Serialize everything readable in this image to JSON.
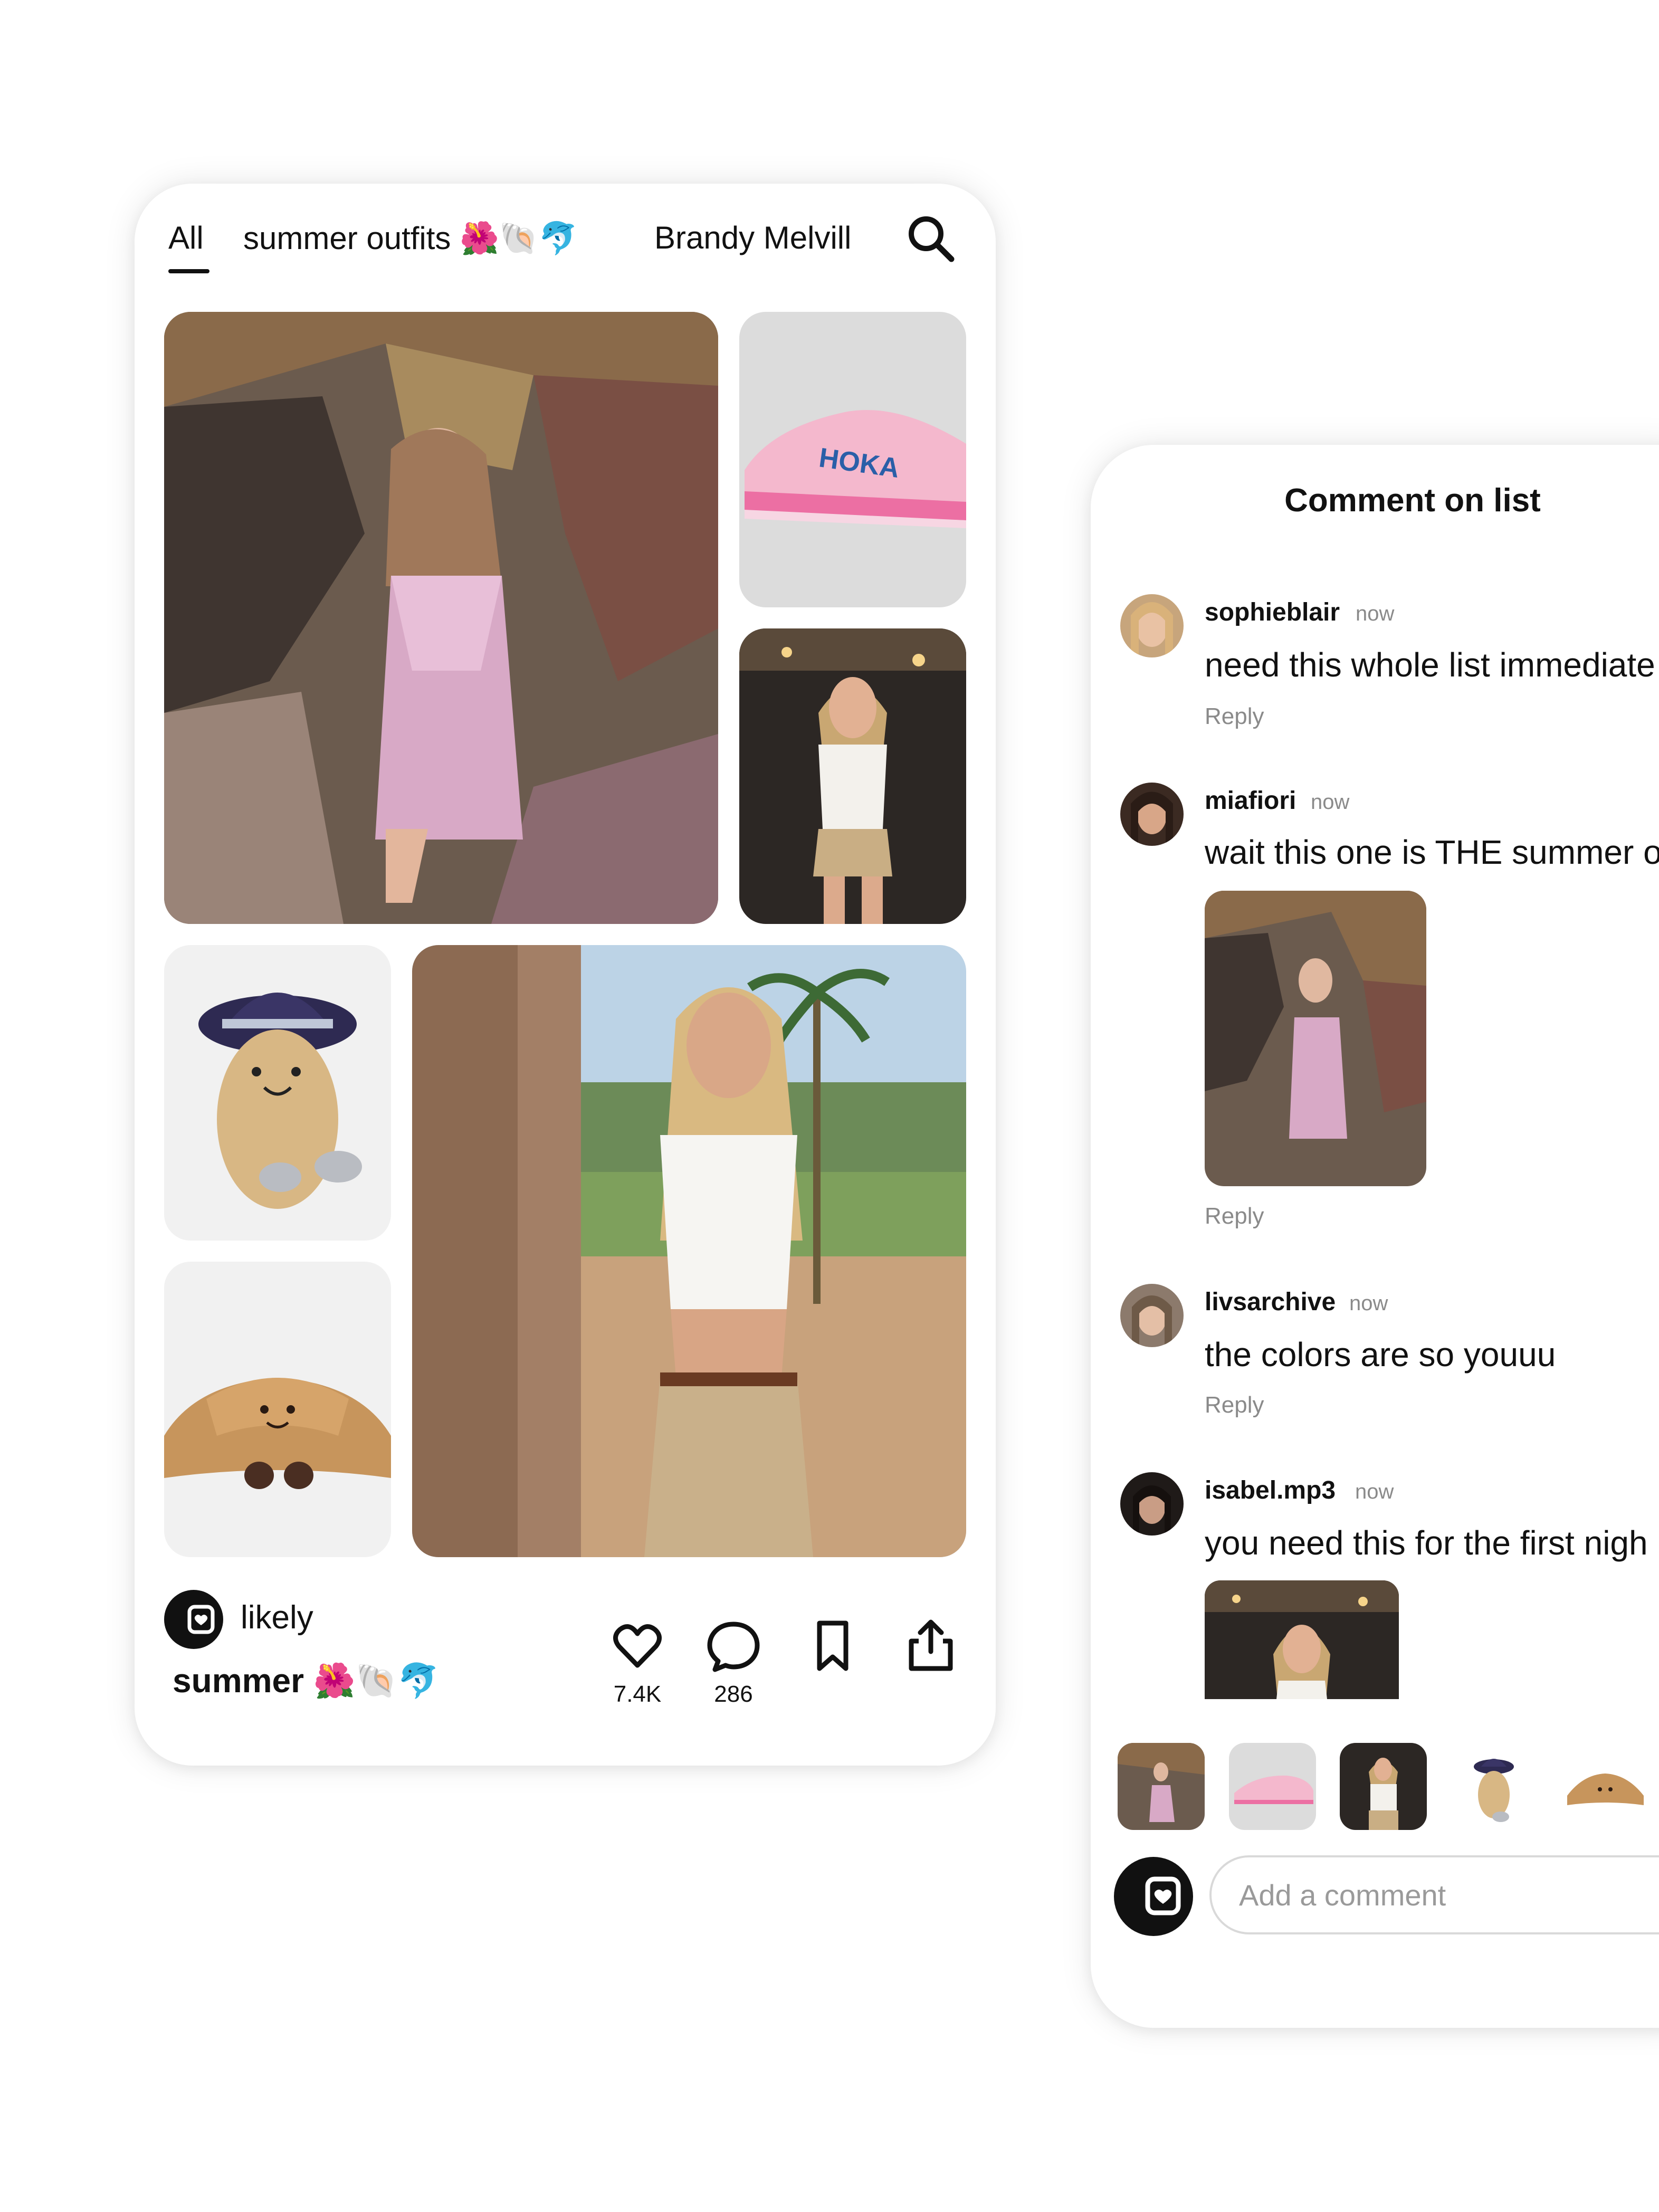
{
  "feed": {
    "tabs": [
      {
        "label": "All"
      },
      {
        "label": "summer outfits 🌺🐚🐬"
      },
      {
        "label": "Brandy Melvill"
      }
    ],
    "brand": "likely",
    "list_title": "summer 🌺🐚🐬",
    "likes": "7.4K",
    "comments_count": "286",
    "icons": {
      "search": "search-icon",
      "like": "heart-icon",
      "comment": "comment-bubble-icon",
      "save": "bookmark-icon",
      "share": "share-icon"
    }
  },
  "comments_panel": {
    "title": "Comment on list",
    "reply_label": "Reply",
    "items": [
      {
        "user": "sophieblair",
        "time": "now",
        "text": "need this whole list immediate"
      },
      {
        "user": "miafiori",
        "time": "now",
        "text": "wait this one is THE summer o"
      },
      {
        "user": "livsarchive",
        "time": "now",
        "text": "the colors are so youuu"
      },
      {
        "user": "isabel.mp3",
        "time": "now",
        "text": "you need this for the first nigh"
      }
    ],
    "input_placeholder": "Add a comment"
  },
  "colors": {
    "accent": "#111111",
    "muted": "#8a8a8a",
    "sneaker_pink": "#f4b8cd",
    "hoka_blue": "#2a5fa8"
  }
}
